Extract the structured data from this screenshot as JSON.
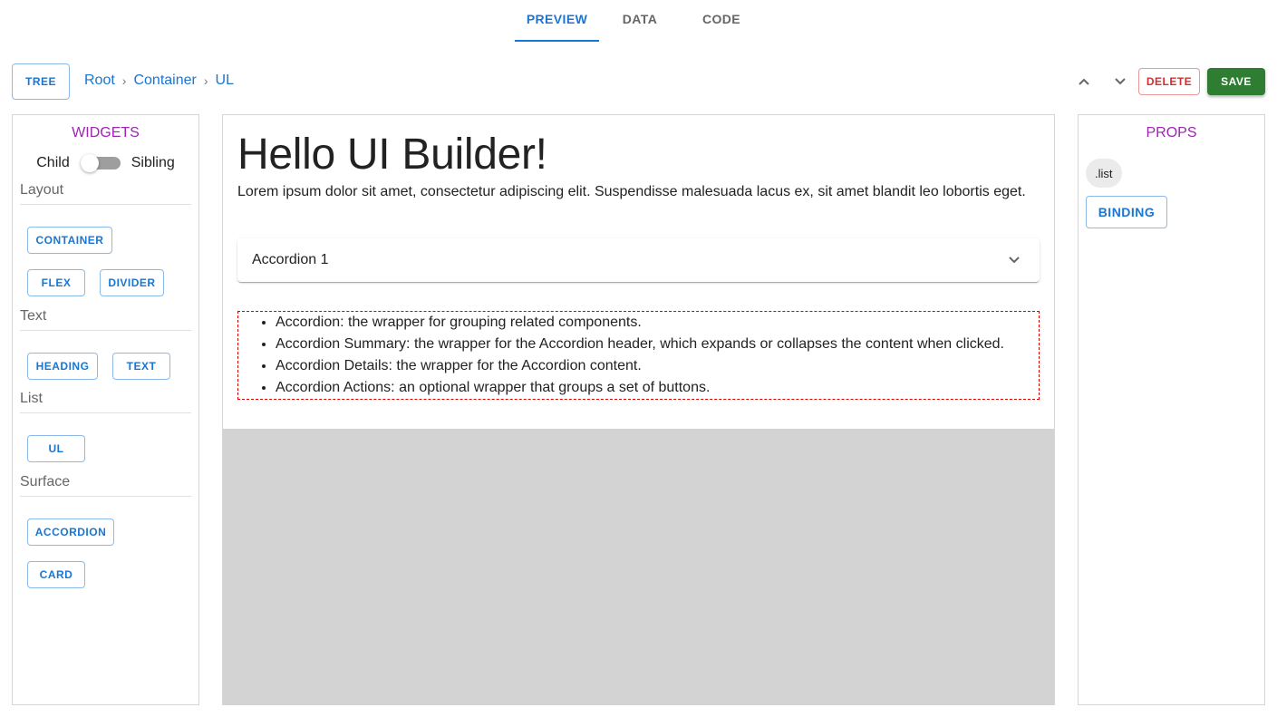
{
  "tabs": [
    {
      "label": "PREVIEW",
      "active": true
    },
    {
      "label": "DATA",
      "active": false
    },
    {
      "label": "CODE",
      "active": false
    }
  ],
  "toolbar": {
    "tree_label": "TREE",
    "breadcrumb": [
      "Root",
      "Container",
      "UL"
    ],
    "breadcrumb_separator": "›",
    "move_up_icon": "chevron-up",
    "move_down_icon": "chevron-down",
    "delete_label": "DELETE",
    "save_label": "SAVE"
  },
  "widgets": {
    "title": "WIDGETS",
    "switch": {
      "left_label": "Child",
      "right_label": "Sibling",
      "checked": false
    },
    "sections": [
      {
        "label": "Layout",
        "items": [
          "CONTAINER",
          "FLEX",
          "DIVIDER"
        ]
      },
      {
        "label": "Text",
        "items": [
          "HEADING",
          "TEXT"
        ]
      },
      {
        "label": "List",
        "items": [
          "UL"
        ]
      },
      {
        "label": "Surface",
        "items": [
          "ACCORDION",
          "CARD"
        ]
      }
    ]
  },
  "canvas": {
    "heading": "Hello UI Builder!",
    "paragraph": "Lorem ipsum dolor sit amet, consectetur adipiscing elit. Suspendisse malesuada lacus ex, sit amet blandit leo lobortis eget.",
    "accordion": {
      "title": "Accordion 1",
      "expanded": false
    },
    "list_items": [
      "Accordion: the wrapper for grouping related components.",
      "Accordion Summary: the wrapper for the Accordion header, which expands or collapses the content when clicked.",
      "Accordion Details: the wrapper for the Accordion content.",
      "Accordion Actions: an optional wrapper that groups a set of buttons."
    ]
  },
  "props": {
    "title": "PROPS",
    "chip": ".list",
    "binding_label": "BINDING"
  },
  "colors": {
    "primary": "#1976d2",
    "secondary": "#9c27b0",
    "error": "#d32f2f",
    "success": "#2e7d32",
    "selection_outline": "#dd0000"
  }
}
